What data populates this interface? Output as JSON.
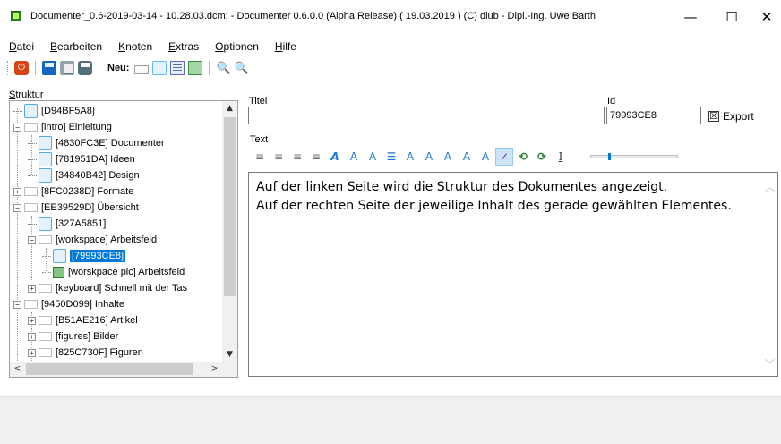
{
  "window": {
    "title": "Documenter_0.6-2019-03-14 - 10.28.03.dcm: - Documenter 0.6.0.0 (Alpha Release)  ( 19.03.2019 ) (C)  diub - Dipl.-Ing. Uwe Barth",
    "minimize": "—",
    "maximize": "☐",
    "close": "✕"
  },
  "menu": [
    "Datei",
    "Bearbeiten",
    "Knoten",
    "Extras",
    "Optionen",
    "Hilfe"
  ],
  "toolbar": {
    "neu_label": "Neu:",
    "power_glyph": "⏻",
    "zoom_glyph": "🔍"
  },
  "tree": {
    "label": "Struktur",
    "nodes": [
      {
        "text": "[D94BF5A8]",
        "icon": "doc-icon"
      },
      {
        "text": "[intro] Einleitung",
        "icon": "empty-node-icon",
        "expander": "−"
      },
      {
        "text": "[4830FC3E] Documenter",
        "icon": "doc-icon"
      },
      {
        "text": "[781951DA] Ideen",
        "icon": "doc-icon"
      },
      {
        "text": "[34840B42] Design",
        "icon": "doc-icon"
      },
      {
        "text": "[8FC0238D] Formate",
        "icon": "empty-node-icon",
        "expander": "+"
      },
      {
        "text": "[EE39529D] Übersicht",
        "icon": "empty-node-icon",
        "expander": "−"
      },
      {
        "text": "[327A5851]",
        "icon": "doc-icon"
      },
      {
        "text": "[workspace] Arbeitsfeld",
        "icon": "empty-node-icon",
        "expander": "−"
      },
      {
        "text": "[79993CE8]",
        "icon": "doc-icon",
        "selected": true
      },
      {
        "text": "[worskpace pic] Arbeitsfeld",
        "icon": "image-icon"
      },
      {
        "text": "[keyboard] Schnell mit der Tas",
        "icon": "empty-node-icon",
        "expander": "+"
      },
      {
        "text": "[9450D099] Inhalte",
        "icon": "empty-node-icon",
        "expander": "−"
      },
      {
        "text": "[B51AE216] Artikel",
        "icon": "empty-node-icon",
        "expander": "+"
      },
      {
        "text": "[figures] Bilder",
        "icon": "empty-node-icon",
        "expander": "+"
      },
      {
        "text": "[825C730F] Figuren",
        "icon": "empty-node-icon",
        "expander": "+"
      }
    ],
    "scroll_up": "▲",
    "scroll_down": "▼",
    "scroll_left": "<",
    "scroll_right": ">"
  },
  "editor": {
    "titel_label": "Titel",
    "titel_value": "",
    "id_label": "Id",
    "id_value": "79993CE8",
    "export_label": "Export",
    "export_checked": "☒",
    "text_label": "Text",
    "text_lines": [
      "Auf der linken Seite wird die Struktur des Dokumentes angezeigt.",
      "Auf der rechten Seite der jeweilige Inhalt des gerade gewählten Elementes."
    ],
    "scroll_up": "︿",
    "scroll_down": "﹀"
  },
  "format_toolbar": {
    "buttons": [
      {
        "name": "align-left-icon",
        "glyph": "≡",
        "style": "gray"
      },
      {
        "name": "align-center-icon",
        "glyph": "≡",
        "style": "gray"
      },
      {
        "name": "align-right-icon",
        "glyph": "≡",
        "style": "gray"
      },
      {
        "name": "justify-icon",
        "glyph": "≡",
        "style": "gray"
      },
      {
        "name": "bold-icon",
        "glyph": "A",
        "style": "bold"
      },
      {
        "name": "italic-icon",
        "glyph": "A",
        "style": ""
      },
      {
        "name": "underline-icon",
        "glyph": "A",
        "style": ""
      },
      {
        "name": "bullet-list-icon",
        "glyph": "☰",
        "style": ""
      },
      {
        "name": "font-grow-icon",
        "glyph": "A",
        "style": ""
      },
      {
        "name": "font-shrink-icon",
        "glyph": "A",
        "style": ""
      },
      {
        "name": "line-spacing-icon",
        "glyph": "A",
        "style": ""
      },
      {
        "name": "char-spacing-icon",
        "glyph": "A",
        "style": ""
      },
      {
        "name": "font-color-icon",
        "glyph": "A",
        "style": ""
      },
      {
        "name": "highlight-icon",
        "glyph": "✓",
        "style": "hilite"
      },
      {
        "name": "undo-icon",
        "glyph": "⟲",
        "style": "green"
      },
      {
        "name": "redo-icon",
        "glyph": "⟳",
        "style": "green"
      },
      {
        "name": "text-cursor-icon",
        "glyph": "I",
        "style": "dark"
      }
    ],
    "zoom_level": 0.2
  }
}
